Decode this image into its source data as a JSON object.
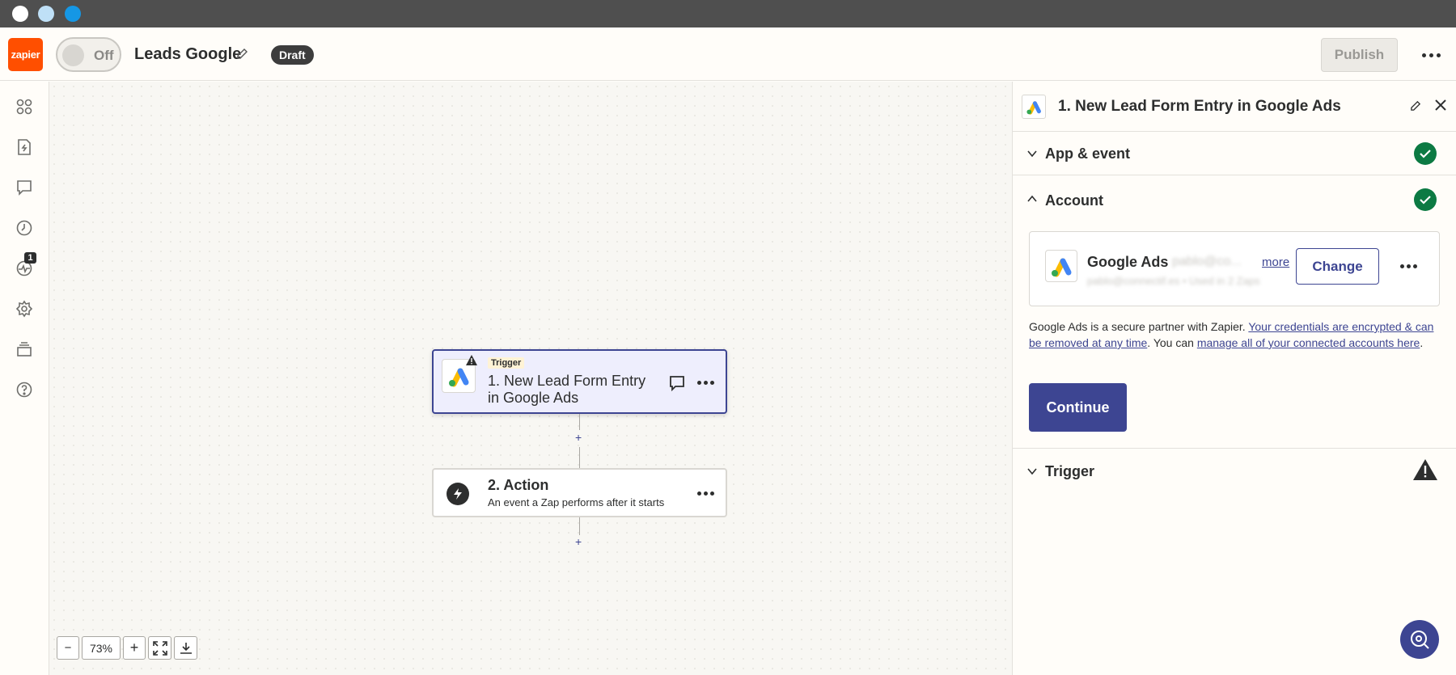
{
  "header": {
    "logo_text": "zapier",
    "toggle_label": "Off",
    "zap_title": "Leads Google",
    "status_badge": "Draft",
    "publish_label": "Publish"
  },
  "rail": {
    "items": [
      {
        "icon": "apps-grid-icon"
      },
      {
        "icon": "zap-file-icon"
      },
      {
        "icon": "comment-icon"
      },
      {
        "icon": "history-clock-icon"
      },
      {
        "icon": "activity-icon",
        "badge": "1"
      },
      {
        "icon": "settings-gear-icon"
      },
      {
        "icon": "versions-stack-icon"
      },
      {
        "icon": "help-question-icon"
      }
    ]
  },
  "canvas": {
    "trigger_step": {
      "tag": "Trigger",
      "title": "1. New Lead Form Entry in Google Ads"
    },
    "action_step": {
      "title": "2. Action",
      "subtitle": "An event a Zap performs after it starts"
    },
    "add_step_symbol": "+",
    "zoom": {
      "minus": "−",
      "level": "73%",
      "plus": "+"
    }
  },
  "panel": {
    "title": "1. New Lead Form Entry in Google Ads",
    "sections": {
      "app_event": "App & event",
      "account": "Account",
      "trigger": "Trigger"
    },
    "account_card": {
      "app_name": "Google Ads",
      "email_blurred": "pablo@co...",
      "more_link": "more",
      "sub_blurred": "pablo@connectif.es • Used in 2 Zaps",
      "change_label": "Change"
    },
    "secure_text_1": "Google Ads is a secure partner with Zapier. ",
    "secure_link_1": "Your credentials are encrypted & can be removed at any time",
    "secure_text_2": ". You can ",
    "secure_link_2": "manage all of your connected accounts here",
    "secure_text_3": ".",
    "continue_label": "Continue"
  },
  "colors": {
    "brand_orange": "#ff4f00",
    "primary": "#3d4592",
    "success": "#0c7a43"
  }
}
